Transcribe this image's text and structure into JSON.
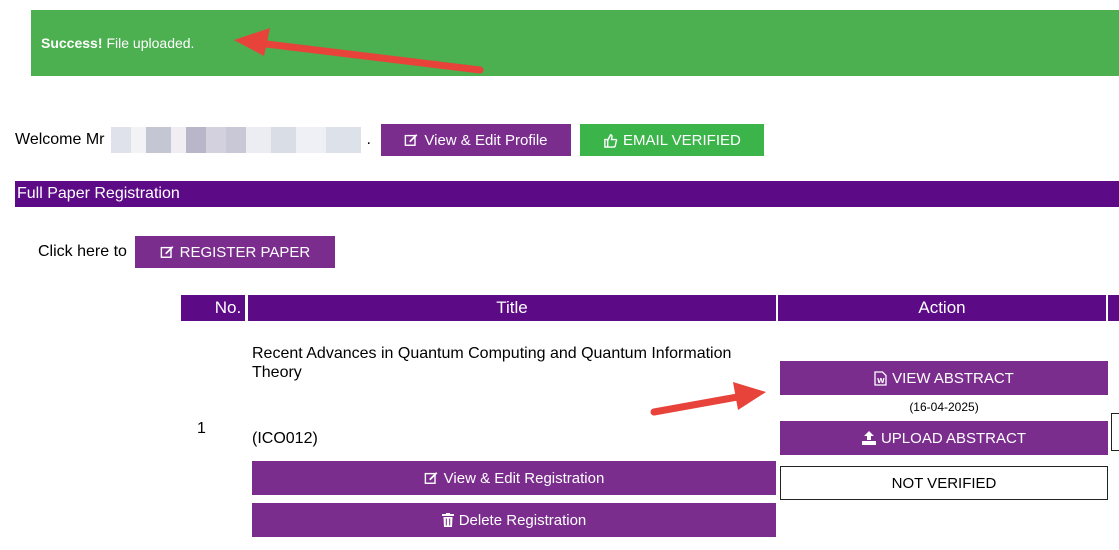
{
  "alert": {
    "strong": "Success!",
    "message": "File uploaded.",
    "bg_color": "#4caf50"
  },
  "welcome": {
    "prefix": "Welcome Mr",
    "suffix": "."
  },
  "profile_button": {
    "label": "View & Edit Profile",
    "icon": "edit-icon"
  },
  "email_badge": {
    "label": "EMAIL VERIFIED",
    "icon": "thumbs-up-icon",
    "color": "#3bb54a"
  },
  "section": {
    "title": "Full Paper Registration",
    "color": "#5d0a86"
  },
  "register": {
    "prompt": "Click here to",
    "button_label": "REGISTER PAPER",
    "icon": "edit-icon"
  },
  "table": {
    "headers": {
      "no": "No.",
      "title": "Title",
      "action": "Action"
    },
    "rows": [
      {
        "no": "1",
        "title": "Recent Advances in Quantum Computing and Quantum Information Theory",
        "code": "(ICO012)",
        "view_edit_label": "View & Edit Registration",
        "delete_label": "Delete Registration",
        "view_abstract_label": "VIEW ABSTRACT",
        "abstract_date": "(16-04-2025)",
        "upload_abstract_label": "UPLOAD ABSTRACT",
        "status": "NOT VERIFIED"
      }
    ]
  },
  "accent_color": "#7b2d8e",
  "annotation_color": "#e8433a"
}
